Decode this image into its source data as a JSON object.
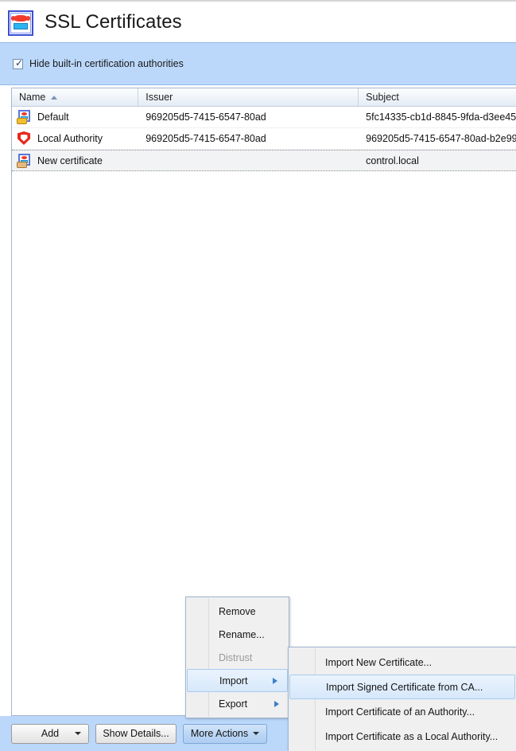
{
  "window": {
    "title": "SSL Certificates",
    "app_icon": "certificate-icon"
  },
  "filter": {
    "checkbox_label": "Hide built-in certification authorities",
    "checked": true,
    "band_color": "#bbd8fb"
  },
  "table": {
    "columns": [
      {
        "key": "name",
        "label": "Name",
        "sorted": "asc"
      },
      {
        "key": "issuer",
        "label": "Issuer",
        "sorted": "none"
      },
      {
        "key": "subject",
        "label": "Subject",
        "sorted": "none"
      }
    ],
    "rows": [
      {
        "icon": "certificate-key-icon",
        "name": "Default",
        "issuer": "969205d5-7415-6547-80ad",
        "subject": "5fc14335-cb1d-8845-9fda-d3ee45",
        "selected": false
      },
      {
        "icon": "shield-icon",
        "name": "Local Authority",
        "issuer": "969205d5-7415-6547-80ad",
        "subject": "969205d5-7415-6547-80ad-b2e99",
        "selected": false
      },
      {
        "icon": "certificate-key-icon",
        "name": "New certificate",
        "issuer": "",
        "subject": "control.local",
        "selected": true
      }
    ]
  },
  "toolbar": {
    "add_label": "Add",
    "show_details_label": "Show Details...",
    "more_actions_label": "More Actions",
    "more_actions_active": true
  },
  "context_menu": {
    "items": [
      {
        "label": "Remove",
        "disabled": false,
        "submenu": false,
        "highlighted": false
      },
      {
        "label": "Rename...",
        "disabled": false,
        "submenu": false,
        "highlighted": false
      },
      {
        "label": "Distrust",
        "disabled": true,
        "submenu": false,
        "highlighted": false
      },
      {
        "label": "Import",
        "disabled": false,
        "submenu": true,
        "highlighted": true
      },
      {
        "label": "Export",
        "disabled": false,
        "submenu": true,
        "highlighted": false
      }
    ]
  },
  "import_submenu": {
    "items": [
      {
        "label": "Import New Certificate...",
        "highlighted": false
      },
      {
        "label": "Import Signed Certificate from CA...",
        "highlighted": true
      },
      {
        "label": "Import Certificate of an Authority...",
        "highlighted": false
      },
      {
        "label": "Import Certificate as a Local Authority...",
        "highlighted": false
      }
    ]
  },
  "colors": {
    "accent_blue": "#bbd8fb",
    "menu_highlight": "#d7e8fb",
    "border": "#a3b7cc"
  }
}
